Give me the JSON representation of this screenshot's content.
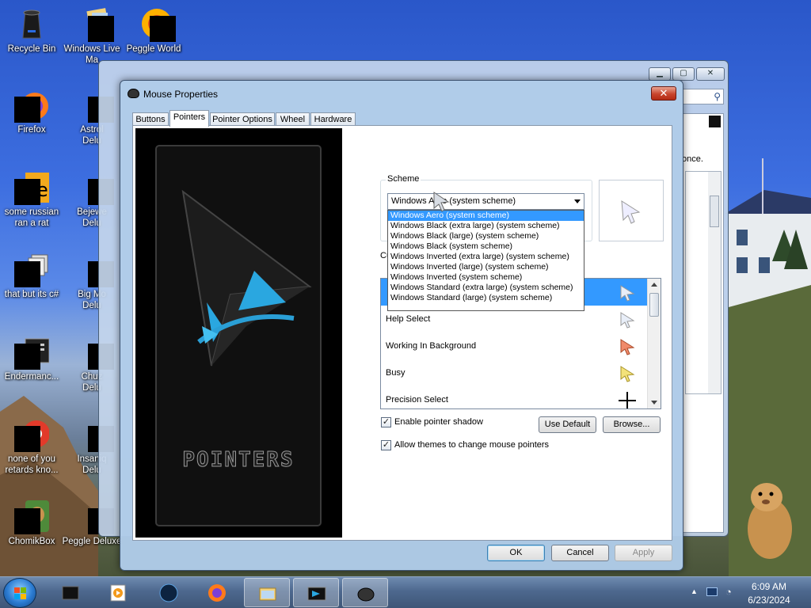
{
  "desktop": {
    "icons": [
      {
        "label": "Recycle Bin",
        "icon": "recycle-bin-icon"
      },
      {
        "label": "Windows Live\nMa",
        "icon": "windows-live-mail-icon"
      },
      {
        "label": "Peggle World",
        "icon": "peggle-icon"
      },
      {
        "label": "Firefox",
        "icon": "firefox-icon"
      },
      {
        "label": "Astrol\nDelu",
        "icon": "astropop-icon"
      },
      {
        "label": "some russian\nran a rat",
        "icon": "folder-icon"
      },
      {
        "label": "Bejewe\nDelu",
        "icon": "bejeweled-icon"
      },
      {
        "label": "that but its c#",
        "icon": "copy-icon"
      },
      {
        "label": "Big Mo\nDelu",
        "icon": "big-money-icon"
      },
      {
        "label": "Endermanc...",
        "icon": "endermanch-icon"
      },
      {
        "label": "Chuz\nDelu",
        "icon": "chuzzle-icon"
      },
      {
        "label": "none of you\nretards kno...",
        "icon": "chrome-icon"
      },
      {
        "label": "Insaniq\nDelu",
        "icon": "insaniquarium-icon"
      },
      {
        "label": "ChomikBox",
        "icon": "chomikbox-icon"
      },
      {
        "label": "Peggle Deluxe",
        "icon": "peggle-deluxe-icon"
      }
    ]
  },
  "background_window": {
    "text_fragment": "once.",
    "buttons": [
      "minimize",
      "maximize",
      "close"
    ]
  },
  "dialog": {
    "title": "Mouse Properties",
    "close_glyph": "✕",
    "tabs": [
      "Buttons",
      "Pointers",
      "Pointer Options",
      "Wheel",
      "Hardware"
    ],
    "active_tab": "Pointers",
    "art_text": "POINTERS",
    "scheme": {
      "label": "Scheme",
      "selected": "Windows Aero (system scheme)",
      "options": [
        "Windows Aero (system scheme)",
        "Windows Black (extra large) (system scheme)",
        "Windows Black (large) (system scheme)",
        "Windows Black (system scheme)",
        "Windows Inverted (extra large) (system scheme)",
        "Windows Inverted (large) (system scheme)",
        "Windows Inverted (system scheme)",
        "Windows Standard (extra large) (system scheme)",
        "Windows Standard (large) (system scheme)"
      ],
      "highlighted_option": "Windows Aero (system scheme)"
    },
    "customize_label_partial": "Cu",
    "pointer_list": [
      {
        "label": "",
        "icon": "normal-select-icon",
        "selected": true
      },
      {
        "label": "Help Select",
        "icon": "help-select-icon"
      },
      {
        "label": "Working In Background",
        "icon": "working-in-background-icon"
      },
      {
        "label": "Busy",
        "icon": "busy-icon"
      },
      {
        "label": "Precision Select",
        "icon": "precision-select-icon"
      }
    ],
    "enable_pointer_shadow": {
      "label": "Enable pointer shadow",
      "checked": true
    },
    "allow_themes": {
      "label": "Allow themes to change mouse pointers",
      "checked": true
    },
    "check_glyph": "✓",
    "use_default_label": "Use Default",
    "browse_label": "Browse...",
    "ok_label": "OK",
    "cancel_label": "Cancel",
    "apply_label": "Apply",
    "apply_enabled": false
  },
  "taskbar": {
    "items": [
      "start-orb",
      "app-black-icon",
      "media-player-icon",
      "endermanch-icon",
      "firefox-icon",
      "explorer-icon",
      "pointers-app-icon",
      "mouse-icon"
    ],
    "active_items": [
      "explorer-icon",
      "pointers-app-icon",
      "mouse-icon"
    ],
    "clock_time": "6:09 AM",
    "clock_date": "6/23/2024"
  },
  "colors": {
    "selection": "#3399ff",
    "desktop_sky": "#2a57c9",
    "dialog_frame": "#b0cbe8",
    "close_button": "#c8452c"
  }
}
